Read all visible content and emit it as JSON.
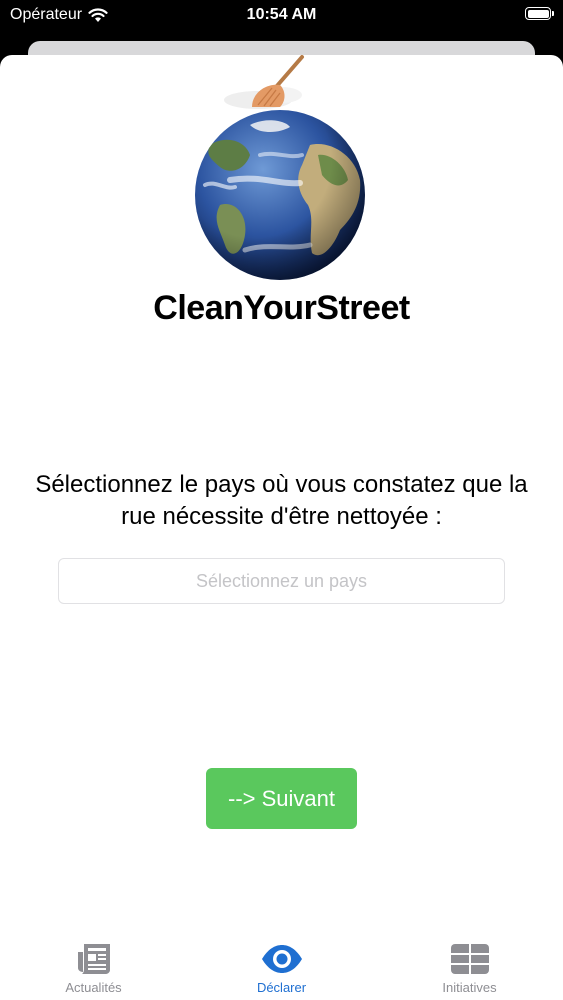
{
  "status_bar": {
    "carrier": "Opérateur",
    "time": "10:54 AM",
    "icons": [
      "wifi-icon",
      "battery-icon"
    ]
  },
  "app": {
    "title": "CleanYourStreet",
    "logo_icon": "earth-broom-logo"
  },
  "form": {
    "prompt": "Sélectionnez le pays où vous constatez que la rue nécessite d'être nettoyée :",
    "country_field": {
      "value": "",
      "placeholder": "Sélectionnez un pays"
    },
    "next_label": "--> Suivant"
  },
  "tab_bar": {
    "tabs": [
      {
        "label": "Actualités",
        "icon": "newspaper-icon",
        "active": false
      },
      {
        "label": "Déclarer",
        "icon": "eye-icon",
        "active": true
      },
      {
        "label": "Initiatives",
        "icon": "grid-icon",
        "active": false
      }
    ]
  },
  "colors": {
    "accent": "#1f6fd1",
    "button": "#5ac85d",
    "inactive": "#8e8e93"
  }
}
